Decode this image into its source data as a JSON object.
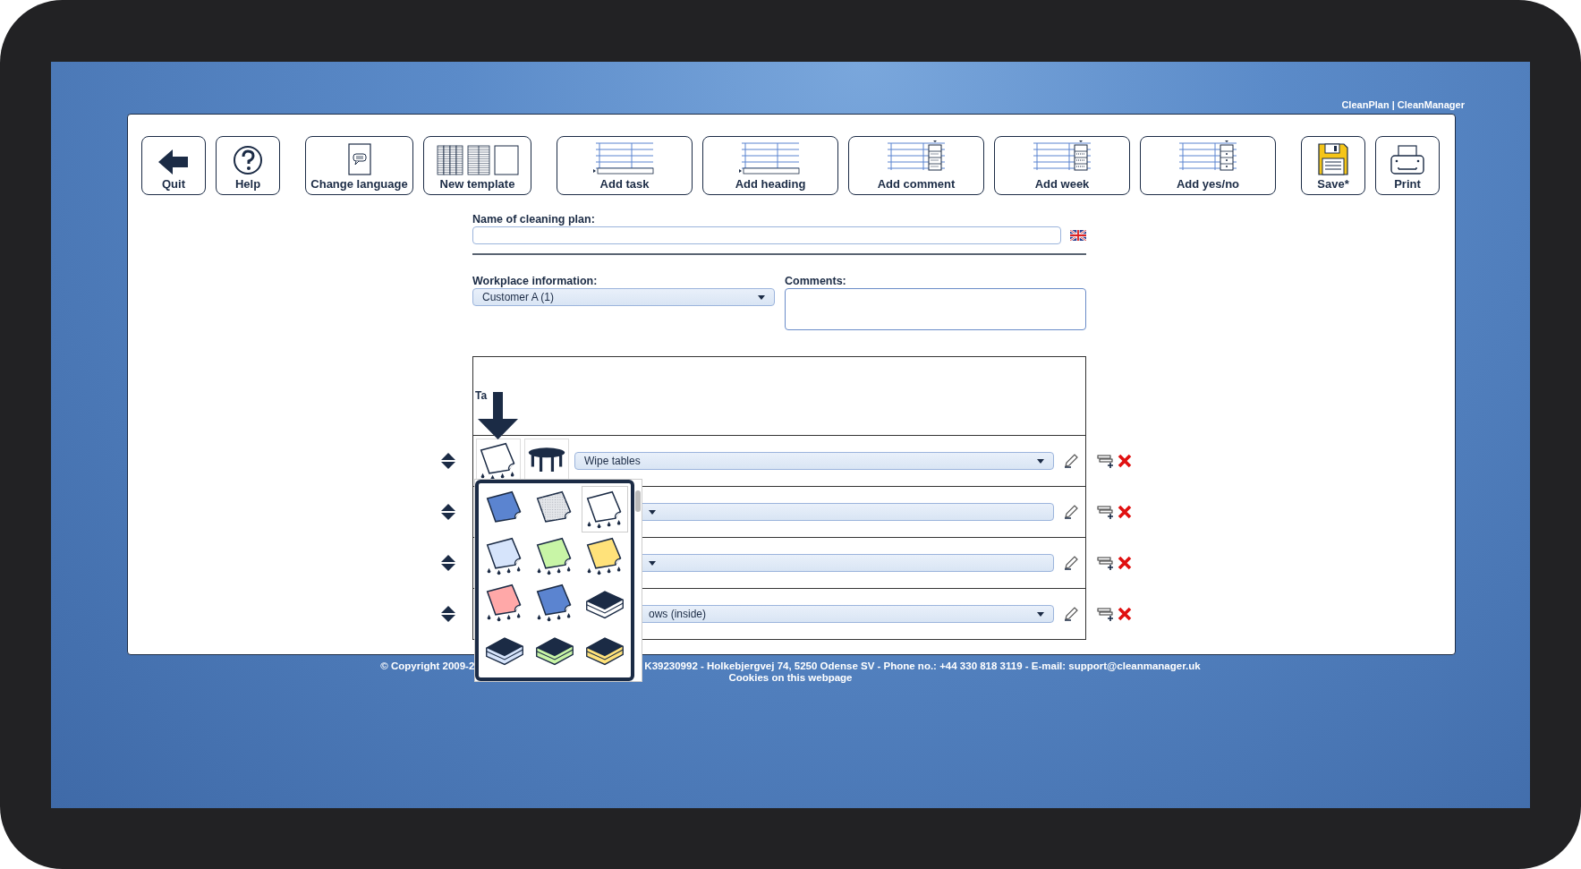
{
  "brand": "CleanPlan | CleanManager",
  "toolbar": [
    [
      {
        "label": "Quit",
        "kind": "quit"
      },
      {
        "label": "Help",
        "kind": "help"
      }
    ],
    [
      {
        "label": "Change language",
        "kind": "language"
      },
      {
        "label": "New template",
        "kind": "template"
      }
    ],
    [
      {
        "label": "Add task",
        "kind": "task"
      },
      {
        "label": "Add heading",
        "kind": "heading"
      },
      {
        "label": "Add comment",
        "kind": "comment"
      },
      {
        "label": "Add week",
        "kind": "week"
      },
      {
        "label": "Add yes/no",
        "kind": "yesno"
      }
    ],
    [
      {
        "label": "Save*",
        "kind": "save"
      },
      {
        "label": "Print",
        "kind": "print"
      }
    ]
  ],
  "plan_name": {
    "label": "Name of cleaning plan:"
  },
  "workplace": {
    "label": "Workplace information:",
    "value": "Customer A (1)"
  },
  "comments": {
    "label": "Comments:"
  },
  "tasks": {
    "heading": "Ta",
    "rows": [
      {
        "task": "Wipe tables",
        "icons": [
          {
            "kind": "wet-cloth"
          },
          {
            "kind": "table"
          }
        ]
      },
      {},
      {},
      {
        "task": "ows (inside)"
      }
    ]
  },
  "picker": [
    {
      "kind": "cloth",
      "color": "#5b84d0",
      "wet": false,
      "selected": false
    },
    {
      "kind": "textured-cloth",
      "color": "#e4e6ea",
      "wet": false,
      "selected": false
    },
    {
      "kind": "cloth",
      "wet": true,
      "selected": true
    },
    {
      "kind": "cloth",
      "color": "#d6e4fb",
      "wet": true,
      "selected": false
    },
    {
      "kind": "cloth",
      "color": "#c8f5a6",
      "wet": true,
      "selected": false
    },
    {
      "kind": "cloth",
      "color": "#ffe27a",
      "wet": true,
      "selected": false
    },
    {
      "kind": "cloth",
      "color": "#ffa8a8",
      "wet": true,
      "selected": false
    },
    {
      "kind": "cloth",
      "color": "#5b84d0",
      "wet": true,
      "selected": false
    },
    {
      "kind": "sponge",
      "selected": false
    },
    {
      "kind": "sponge",
      "color": "#d6e4fb",
      "selected": false
    },
    {
      "kind": "sponge",
      "color": "#c8f5a6",
      "selected": false
    },
    {
      "kind": "sponge",
      "color": "#ffe27a",
      "selected": false
    }
  ],
  "footer": {
    "copyright": "© Copyright 2009-2",
    "address": "K39230992 - Holkebjergvej 74, 5250 Odense SV - Phone no.: +44 330 818 3119 - E-mail: support@cleanmanager.uk",
    "cookies": "Cookies on this webpage"
  }
}
